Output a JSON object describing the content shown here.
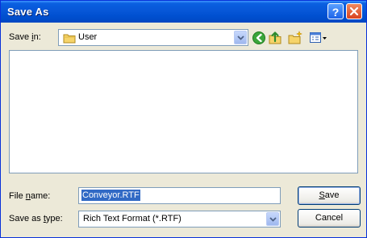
{
  "window": {
    "title": "Save As"
  },
  "titlebar": {
    "help_glyph": "?"
  },
  "save_in": {
    "label_before": "Save ",
    "label_mnemonic": "i",
    "label_after": "n:",
    "value": "User"
  },
  "toolbar": {
    "icons": [
      "back-icon",
      "up-folder-icon",
      "new-folder-icon",
      "views-menu-icon"
    ]
  },
  "file_name": {
    "label_before": "File ",
    "label_mnemonic": "n",
    "label_after": "ame:",
    "value": "Conveyor.RTF"
  },
  "save_as_type": {
    "label_before": "Save as ",
    "label_mnemonic": "t",
    "label_after": "ype:",
    "value": "Rich Text Format (*.RTF)"
  },
  "buttons": {
    "save_mnemonic": "S",
    "save_rest": "ave",
    "cancel": "Cancel"
  },
  "colors": {
    "titlebar": "#0757d8",
    "dialog_bg": "#ece9d8",
    "selection": "#316ac5",
    "close_button": "#d94320"
  }
}
